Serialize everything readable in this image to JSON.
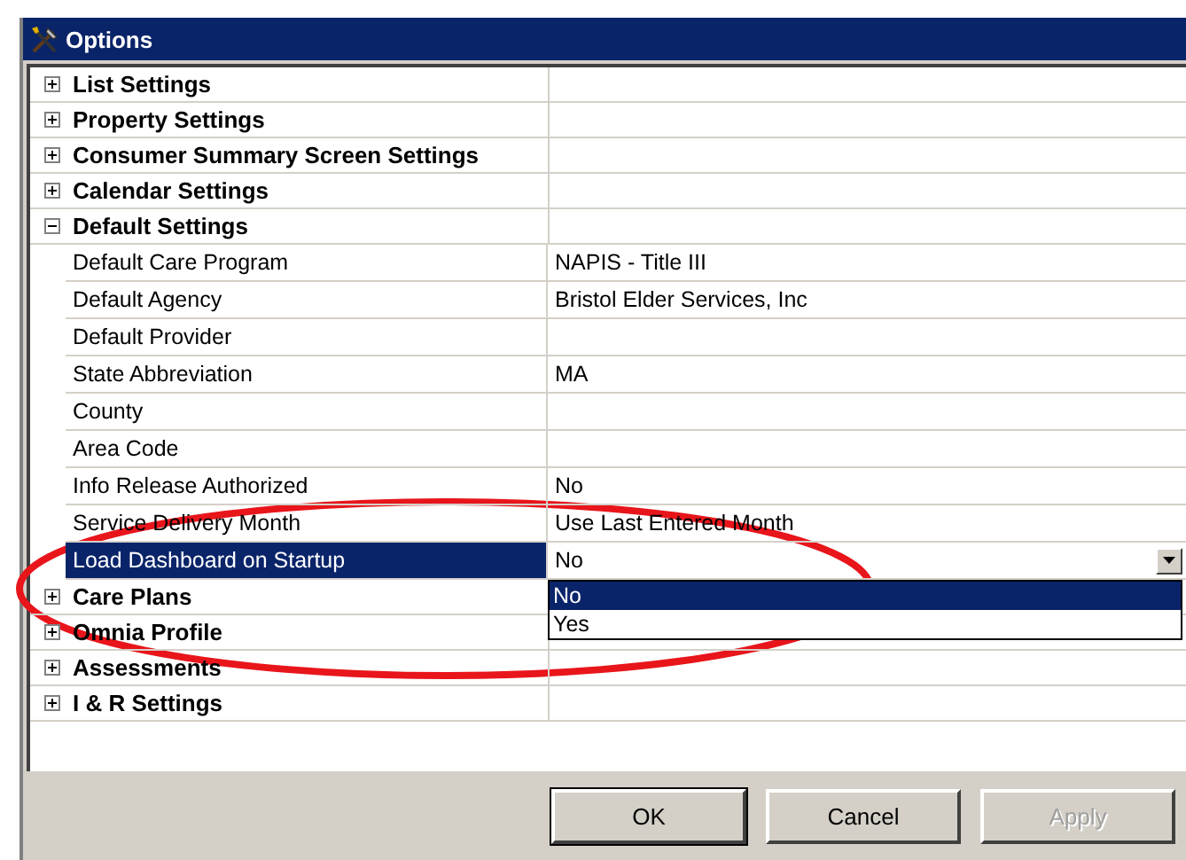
{
  "window": {
    "title": "Options"
  },
  "categories": [
    {
      "label": "List Settings",
      "expanded": false
    },
    {
      "label": "Property Settings",
      "expanded": false
    },
    {
      "label": "Consumer Summary Screen Settings",
      "expanded": false
    },
    {
      "label": "Calendar Settings",
      "expanded": false
    },
    {
      "label": "Default Settings",
      "expanded": true,
      "children": [
        {
          "name": "Default Care Program",
          "value": "NAPIS - Title III",
          "selected": false
        },
        {
          "name": "Default Agency",
          "value": "Bristol Elder Services, Inc",
          "selected": false
        },
        {
          "name": "Default Provider",
          "selected": false
        },
        {
          "name": "State Abbreviation",
          "value": "MA",
          "selected": false
        },
        {
          "name": "County",
          "selected": false
        },
        {
          "name": "Area Code",
          "selected": false
        },
        {
          "name": "Info Release Authorized",
          "value": "No",
          "selected": false
        },
        {
          "name": "Service Delivery Month",
          "value": "Use Last Entered Month",
          "selected": false
        },
        {
          "name": "Load Dashboard on Startup",
          "value": "No",
          "selected": true,
          "dropdown": {
            "options": [
              {
                "label": "No",
                "selected": true
              },
              {
                "label": "Yes",
                "selected": false
              }
            ]
          }
        }
      ]
    },
    {
      "label": "Care Plans",
      "expanded": false
    },
    {
      "label": "Omnia Profile",
      "expanded": false
    },
    {
      "label": "Assessments",
      "expanded": false
    },
    {
      "label": "I & R Settings",
      "expanded": false
    }
  ],
  "buttons": [
    {
      "label": "OK",
      "disabled": false
    },
    {
      "label": "Cancel",
      "disabled": false
    },
    {
      "label": "Apply",
      "disabled": true
    }
  ]
}
